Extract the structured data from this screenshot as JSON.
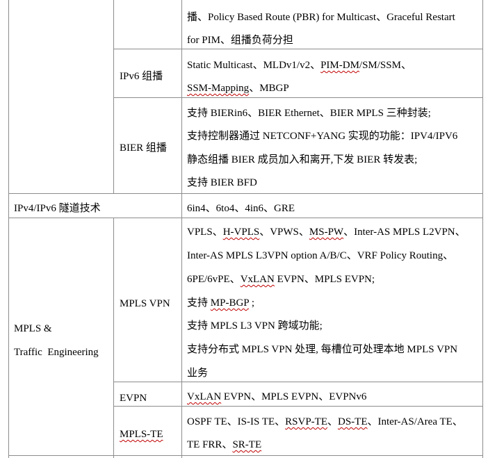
{
  "rows": {
    "multicast_ipv4_cont": {
      "features": [
        "播、Policy Based Route (PBR) for Multicast、Graceful Restart",
        "for PIM、组播负荷分担"
      ]
    },
    "ipv6_multicast": {
      "subcategory": "IPv6 组播",
      "line1": {
        "a": "Static Multicast、MLDv1/v2、",
        "b": "PIM-DM",
        "c": "/SM/SSM、"
      },
      "line2": {
        "a": "SSM-Mapping",
        "b": "、MBGP"
      }
    },
    "bier_multicast": {
      "subcategory": "BIER 组播",
      "features": [
        "支持 BIERin6、BIER Ethernet、BIER MPLS 三种封装;",
        "支持控制器通过 NETCONF+YANG 实现的功能：IPV4/IPV6",
        "静态组播 BIER 成员加入和离开,下发 BIER 转发表;",
        "支持 BIER BFD"
      ]
    },
    "ip_tunnel": {
      "category": "IPv4/IPv6 隧道技术",
      "features": [
        "6in4、6to4、4in6、GRE"
      ]
    },
    "mpls_te": {
      "category_line1": "MPLS &",
      "category_line2": "Traffic  Engineering",
      "mpls_vpn": {
        "subcategory": "MPLS VPN",
        "line1": {
          "a": "VPLS、",
          "b": "H-VPLS",
          "c": "、VPWS、",
          "d": "MS-PW",
          "e": "、Inter-AS MPLS L2VPN、"
        },
        "line2": "Inter-AS MPLS L3VPN option A/B/C、VRF Policy Routing、",
        "line3": {
          "a": "6PE/6vPE、",
          "b": "VxLAN",
          "c": " EVPN、MPLS EVPN;"
        },
        "line4": {
          "a": "支持 ",
          "b": "MP-BGP",
          "c": " ;"
        },
        "line5": "支持 MPLS L3 VPN 跨域功能;",
        "line6": "支持分布式 MPLS VPN 处理, 每槽位可处理本地 MPLS VPN",
        "line7": "业务"
      },
      "evpn": {
        "subcategory": "EVPN",
        "line1": {
          "a": "VxLAN",
          "b": " EVPN、MPLS EVPN、EVPNv6"
        }
      },
      "te": {
        "subcategory": "MPLS-TE",
        "line1": {
          "a": "OSPF TE、IS-IS TE、",
          "b": "RSVP-TE",
          "c": "、",
          "d": "DS-TE",
          "e": "、Inter-AS/Area TE、"
        },
        "line2": {
          "a": "TE FRR、",
          "b": "SR-TE"
        }
      }
    }
  },
  "colors": {
    "border": "#8c8c8c",
    "spellcheck_underline": "#c00000",
    "text": "#000000"
  }
}
